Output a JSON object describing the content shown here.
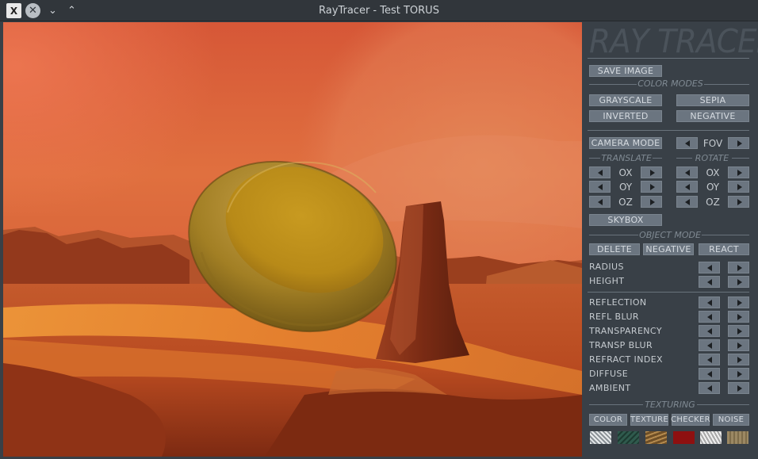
{
  "window": {
    "title": "RayTracer - Test TORUS",
    "app_icon_glyph": "X",
    "close_glyph": "✕",
    "minimize_glyph": "⌄",
    "maximize_glyph": "⌃"
  },
  "panel": {
    "logo": "RAY TRACER",
    "save_image": "SAVE IMAGE",
    "color_modes": {
      "heading": "COLOR MODES",
      "grayscale": "GRAYSCALE",
      "sepia": "SEPIA",
      "inverted": "INVERTED",
      "negative": "NEGATIVE"
    },
    "camera": {
      "camera_mode": "CAMERA MODE",
      "fov": "FOV",
      "translate": "TRANSLATE",
      "rotate": "ROTATE",
      "ox": "OX",
      "oy": "OY",
      "oz": "OZ",
      "skybox": "SKYBOX"
    },
    "object": {
      "heading": "OBJECT MODE",
      "delete": "DELETE",
      "negative": "NEGATIVE",
      "react": "REACT",
      "radius": "RADIUS",
      "height": "HEIGHT"
    },
    "material": {
      "reflection": "REFLECTION",
      "refl_blur": "REFL  BLUR",
      "transparency": "TRANSPARENCY",
      "transp_blur": "TRANSP  BLUR",
      "refract_index": "REFRACT INDEX",
      "diffuse": "DIFFUSE",
      "ambient": "AMBIENT"
    },
    "texturing": {
      "heading": "TEXTURING",
      "color": "COLOR",
      "texture": "TEXTURE",
      "checker": "CHECKER",
      "noise": "NOISE",
      "swatches": [
        "#d8dbdc",
        "#2f5a4d",
        "#8e6c3e",
        "#8e1010",
        "#e7e7e7",
        "#8f7d5a"
      ]
    }
  },
  "colors": {
    "sky_top": "#d9583a",
    "sky_mid": "#e57a45",
    "ground": "#a2451f",
    "torus_gold": "#b8901d"
  }
}
